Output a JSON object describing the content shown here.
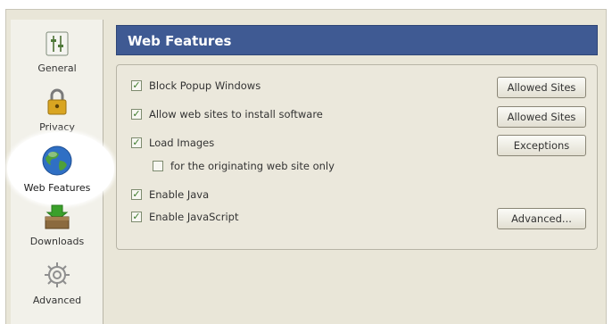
{
  "sidebar": {
    "items": [
      {
        "label": "General",
        "icon": "general-icon"
      },
      {
        "label": "Privacy",
        "icon": "lock-icon"
      },
      {
        "label": "Web Features",
        "icon": "globe-icon",
        "selected": true
      },
      {
        "label": "Downloads",
        "icon": "download-box-icon"
      },
      {
        "label": "Advanced",
        "icon": "gear-icon"
      }
    ]
  },
  "panel": {
    "title": "Web Features",
    "options": [
      {
        "label": "Block Popup Windows",
        "checked": true
      },
      {
        "label": "Allow web sites to install software",
        "checked": true
      },
      {
        "label": "Load Images",
        "checked": true
      },
      {
        "label": "for the originating web site only",
        "checked": false
      },
      {
        "label": "Enable Java",
        "checked": true
      },
      {
        "label": "Enable JavaScript",
        "checked": true
      }
    ],
    "buttons": {
      "allowed_sites_popup": "Allowed Sites",
      "allowed_sites_install": "Allowed Sites",
      "exceptions": "Exceptions",
      "advanced": "Advanced..."
    }
  },
  "colors": {
    "header_bg": "#3f5a93",
    "window_bg": "#e9e6d8",
    "sidebar_bg": "#f2f1ea"
  }
}
